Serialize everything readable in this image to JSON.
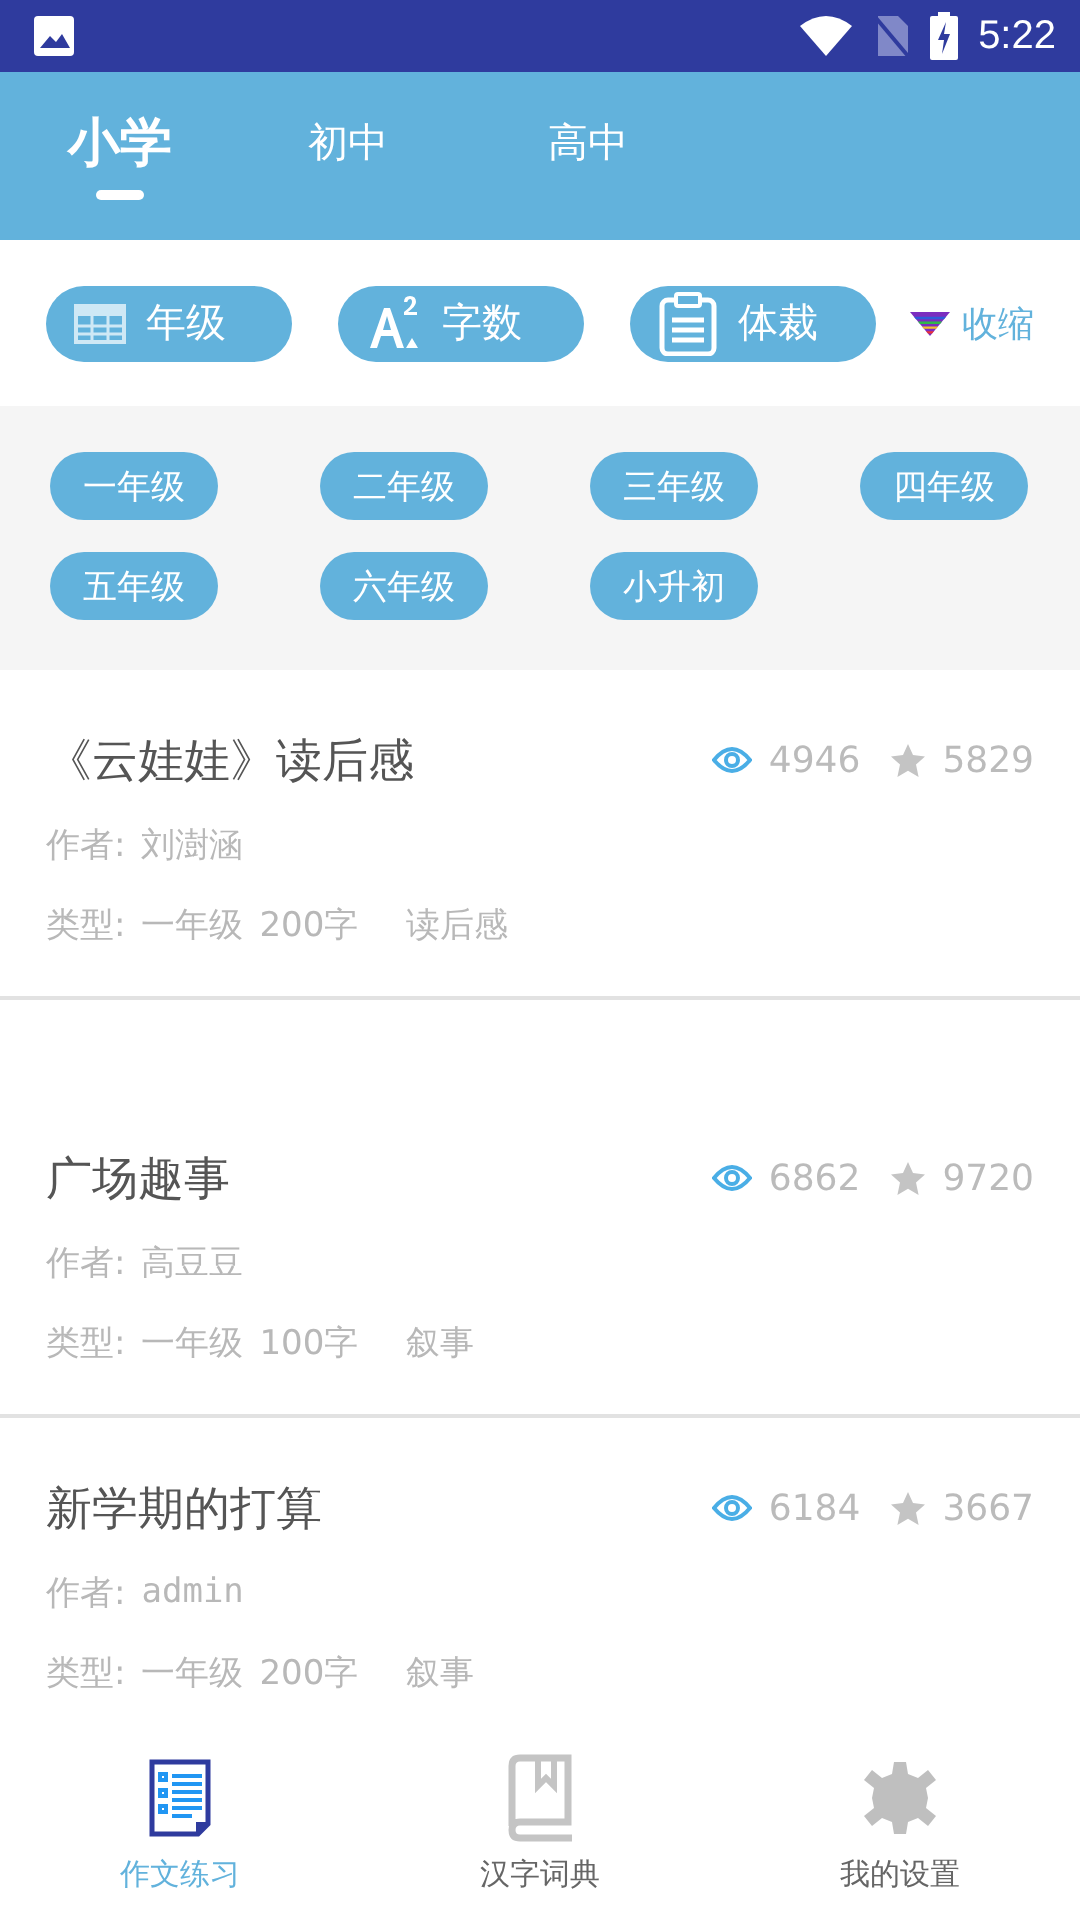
{
  "status_bar": {
    "time": "5:22"
  },
  "tabs": [
    {
      "label": "小学",
      "selected": true
    },
    {
      "label": "初中",
      "selected": false
    },
    {
      "label": "高中",
      "selected": false
    }
  ],
  "filters": [
    {
      "kind": "grade",
      "label": "年级"
    },
    {
      "kind": "words",
      "label": "字数"
    },
    {
      "kind": "genre",
      "label": "体裁"
    }
  ],
  "collapse_link": "收缩",
  "grades": [
    "一年级",
    "二年级",
    "三年级",
    "四年级",
    "五年级",
    "六年级",
    "小升初"
  ],
  "essays": [
    {
      "title": "《云娃娃》读后感",
      "views": "4946",
      "favorites": "5829",
      "author_label": "作者:",
      "author": "刘澍涵",
      "type_label": "类型:",
      "grade": "一年级",
      "words": "200字",
      "genre": "读后感",
      "gap_before": false
    },
    {
      "title": "广场趣事",
      "views": "6862",
      "favorites": "9720",
      "author_label": "作者:",
      "author": "高豆豆",
      "type_label": "类型:",
      "grade": "一年级",
      "words": "100字",
      "genre": "叙事",
      "gap_before": true
    },
    {
      "title": "新学期的打算",
      "views": "6184",
      "favorites": "3667",
      "author_label": "作者:",
      "author": "admin",
      "type_label": "类型:",
      "grade": "一年级",
      "words": "200字",
      "genre": "叙事",
      "gap_before": false
    }
  ],
  "bottom_nav": [
    {
      "kind": "essay",
      "label": "作文练习",
      "selected": true
    },
    {
      "kind": "dictionary",
      "label": "汉字词典",
      "selected": false
    },
    {
      "kind": "settings",
      "label": "我的设置",
      "selected": false
    }
  ]
}
